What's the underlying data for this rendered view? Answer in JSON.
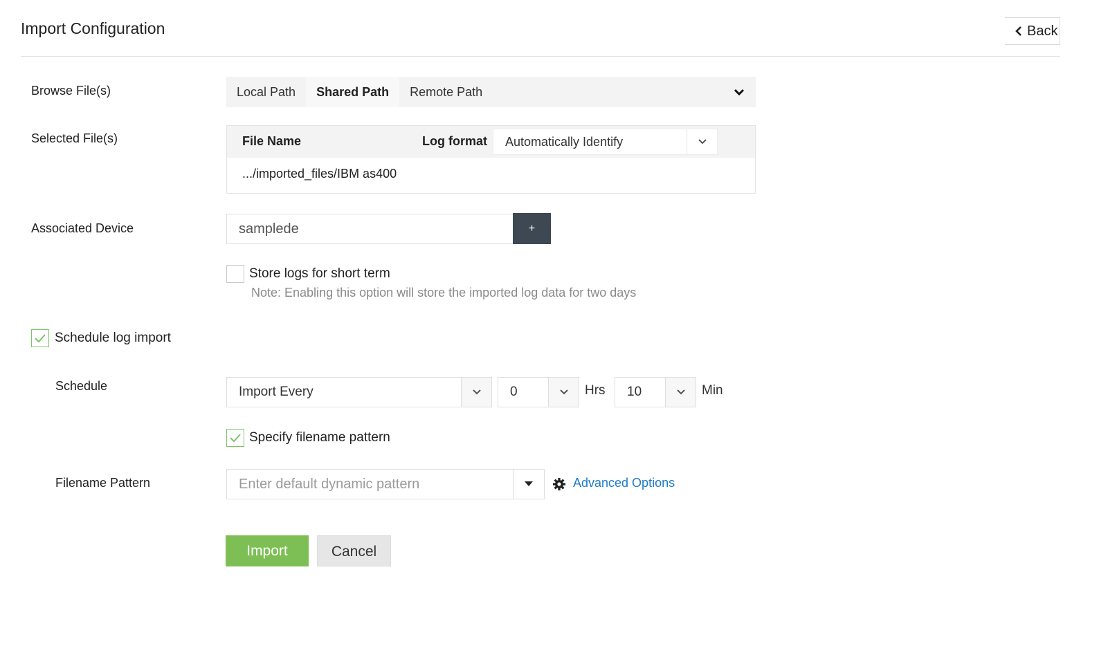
{
  "header": {
    "title": "Import Configuration",
    "back_label": "Back"
  },
  "form": {
    "browse_label": "Browse File(s)",
    "path_tabs": [
      {
        "label": "Local Path",
        "active": false
      },
      {
        "label": "Shared Path",
        "active": true
      },
      {
        "label": "Remote Path",
        "active": false
      }
    ],
    "selected_label": "Selected File(s)",
    "files_table": {
      "col_file": "File Name",
      "col_log": "Log format",
      "log_format_value": "Automatically Identify",
      "rows": [
        {
          "file": ".../imported_files/IBM as400"
        }
      ]
    },
    "device_label": "Associated Device",
    "device_value": "samplede",
    "add_device_label": "+",
    "store_short_term": {
      "label": "Store logs for short term",
      "checked": false,
      "note": "Note: Enabling this option will store the imported log data for two days"
    },
    "schedule_import": {
      "label": "Schedule log import",
      "checked": true
    },
    "schedule_label": "Schedule",
    "schedule": {
      "mode": "Import Every",
      "hours": "0",
      "hours_unit": "Hrs",
      "minutes": "10",
      "minutes_unit": "Min"
    },
    "specify_pattern": {
      "label": "Specify filename pattern",
      "checked": true
    },
    "pattern_label": "Filename Pattern",
    "pattern_placeholder": "Enter default dynamic pattern",
    "advanced_options_label": "Advanced Options"
  },
  "actions": {
    "import_label": "Import",
    "cancel_label": "Cancel"
  },
  "colors": {
    "primary_green": "#7dbf55",
    "check_green": "#7cc46a",
    "link_blue": "#1d7ac9",
    "dark_button": "#3d4852"
  }
}
